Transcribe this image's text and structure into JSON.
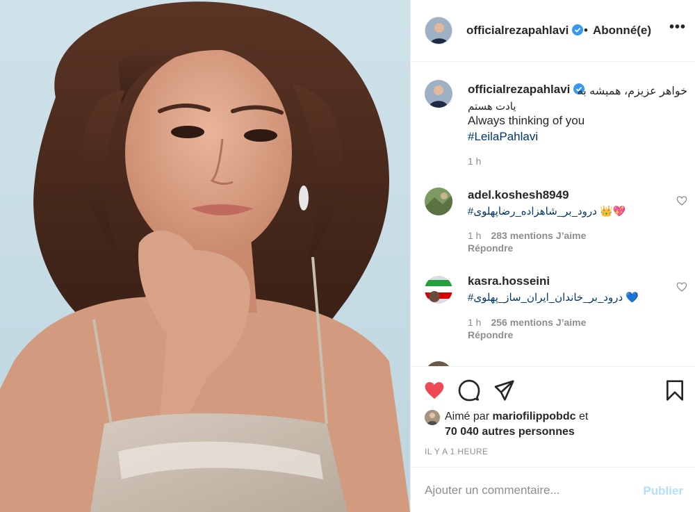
{
  "post_owner": {
    "username": "officialrezapahlavi",
    "separator": "•",
    "follow_status": "Abonné(e)",
    "more_label": "•••"
  },
  "caption": {
    "username": "officialrezapahlavi",
    "persian_line1": "خواهر عزیزم، همیشه به",
    "persian_line2": "یادت هستم",
    "english": "Always thinking of you",
    "hashtag": "#LeilaPahlavi",
    "time": "1 h"
  },
  "comments": [
    {
      "username": "adel.koshesh8949",
      "text": "#درود_بر_شاهزاده_رضاپهلوی 👑💖",
      "time": "1 h",
      "likes": "283 mentions J’aime",
      "reply": "Répondre"
    },
    {
      "username": "kasra.hosseini",
      "text": "#درود_بر_خاندان_ایران_ساز_پهلوی 💙",
      "time": "1 h",
      "likes": "256 mentions J’aime",
      "reply": "Répondre"
    }
  ],
  "likes": {
    "prefix": "Aimé par",
    "user": "mariofilippobdc",
    "conj": "et",
    "others": "70 040 autres personnes"
  },
  "timestamp": "IL Y A 1 HEURE",
  "add_comment": {
    "placeholder": "Ajouter un commentaire...",
    "publish": "Publier"
  },
  "colors": {
    "liked_heart": "#ed4956",
    "verified": "#3897f0",
    "hashtag": "#00376b",
    "publish_disabled": "#b2dffc"
  }
}
